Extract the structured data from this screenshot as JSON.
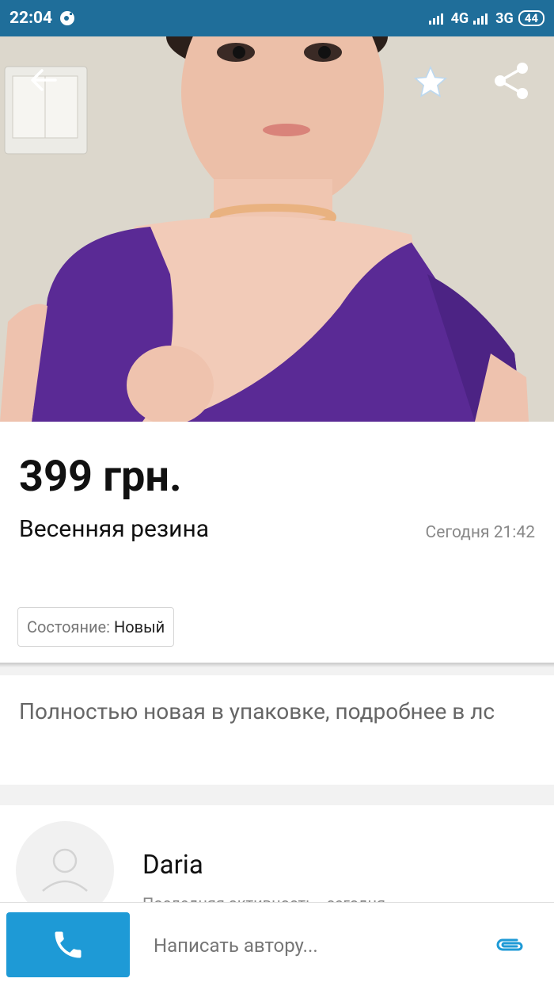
{
  "status_bar": {
    "time": "22:04",
    "network_1": "4G",
    "network_2": "3G",
    "battery": "44"
  },
  "hero": {
    "back_icon": "arrow-left-icon",
    "favorite_icon": "star-icon",
    "share_icon": "share-icon"
  },
  "listing": {
    "price": "399 грн.",
    "title": "Весенняя резина",
    "date": "Сегодня 21:42",
    "condition_label": "Состояние:",
    "condition_value": "Новый"
  },
  "description": {
    "text": "Полностью новая в упаковке, подробнее в лс"
  },
  "seller": {
    "name": "Daria",
    "activity": "Последняя активность - сегодня"
  },
  "bottom_bar": {
    "call_icon": "phone-icon",
    "message_placeholder": "Написать автору...",
    "attach_icon": "paperclip-icon"
  },
  "colors": {
    "status_bar": "#1f6e9a",
    "call_button": "#1e9ad6",
    "attach_icon": "#1e9ad6"
  }
}
